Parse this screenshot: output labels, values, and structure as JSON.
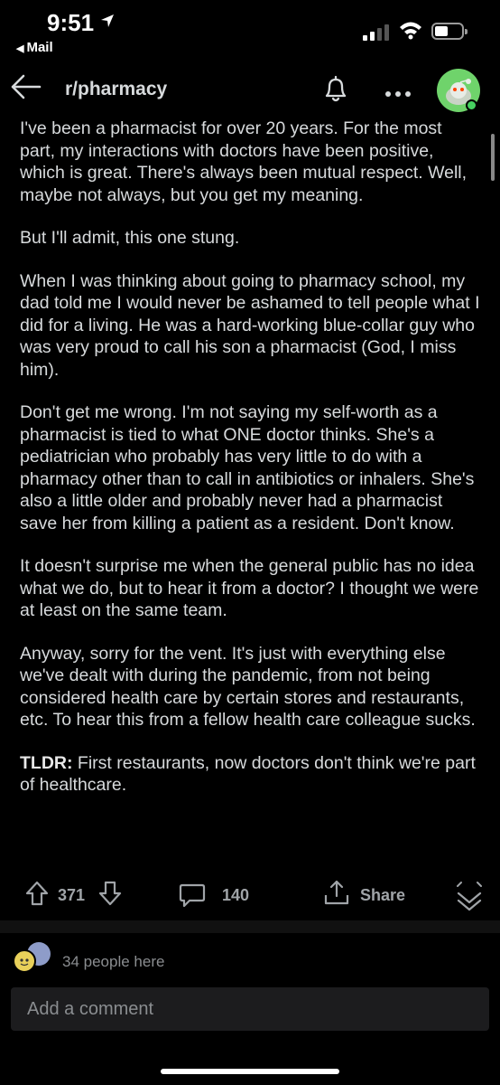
{
  "status_bar": {
    "time": "9:51",
    "back_app": "Mail",
    "icons": [
      "location-arrow-icon",
      "signal-icon",
      "wifi-icon",
      "battery-icon"
    ]
  },
  "header": {
    "subreddit": "r/pharmacy",
    "icons": [
      "back-arrow-icon",
      "bell-icon",
      "more-icon",
      "avatar"
    ]
  },
  "post": {
    "paragraphs": [
      "I've been a pharmacist for over 20 years. For the most part, my interactions with doctors have been positive, which is great. There's always been mutual respect. Well, maybe not always, but you get my meaning.",
      "But I'll admit, this one stung.",
      "When I was thinking about going to pharmacy school, my dad told me I would never be ashamed to tell people what I did for a living. He was a hard-working blue-collar guy who was very proud to call his son a pharmacist (God, I miss him).",
      "Don't get me wrong. I'm not saying my self-worth as a pharmacist is tied to what ONE doctor thinks. She's a pediatrician who probably has very little to do with a pharmacy other than to call in antibiotics or inhalers. She's also a little older and probably never had a pharmacist save her from killing a patient as a resident. Don't know.",
      "It doesn't surprise me when the general public has no idea what we do, but to hear it from a doctor? I thought we were at least on the same team.",
      "Anyway, sorry for the vent. It's just with everything else we've dealt with during the pandemic, from not being considered health care by certain stores and restaurants, etc. To hear this from a fellow health care colleague sucks."
    ],
    "tldr_label": "TLDR:",
    "tldr_text": " First restaurants, now doctors don't think we're part of healthcare."
  },
  "actions": {
    "score": "371",
    "comments": "140",
    "share_label": "Share"
  },
  "presence": {
    "text": "34 people here"
  },
  "comment_input": {
    "placeholder": "Add a comment"
  },
  "colors": {
    "background": "#000000",
    "text": "#d7dadc",
    "muted": "#8a8d90",
    "avatar_green": "#6fd36b"
  }
}
